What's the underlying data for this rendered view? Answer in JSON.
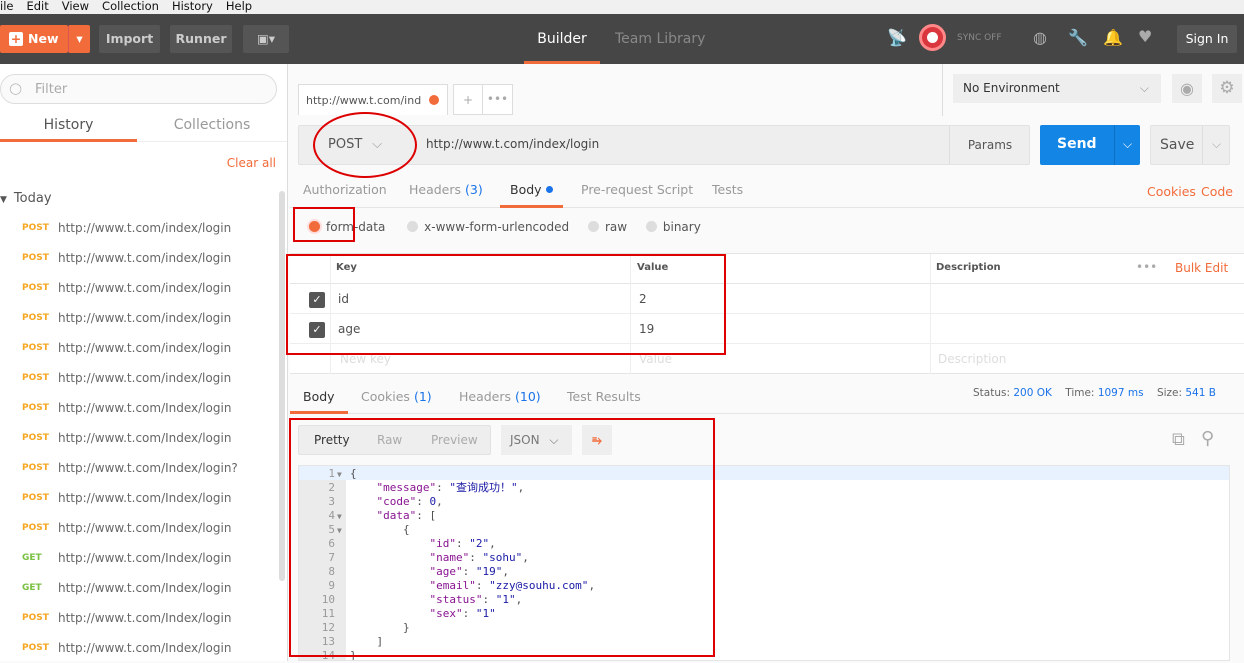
{
  "menu": [
    "ile",
    "Edit",
    "View",
    "Collection",
    "History",
    "Help"
  ],
  "topbar": {
    "new_label": "New",
    "import_label": "Import",
    "runner_label": "Runner",
    "tabs": [
      "Builder",
      "Team Library"
    ],
    "sync_label": "SYNC OFF",
    "sign_in_label": "Sign In"
  },
  "sidebar": {
    "filter_placeholder": "Filter",
    "tabs": [
      "History",
      "Collections"
    ],
    "clear_all": "Clear all",
    "group": "Today",
    "items": [
      {
        "method": "POST",
        "url": "http://www.t.com/index/login"
      },
      {
        "method": "POST",
        "url": "http://www.t.com/index/login"
      },
      {
        "method": "POST",
        "url": "http://www.t.com/index/login"
      },
      {
        "method": "POST",
        "url": "http://www.t.com/index/login"
      },
      {
        "method": "POST",
        "url": "http://www.t.com/index/login"
      },
      {
        "method": "POST",
        "url": "http://www.t.com/index/login"
      },
      {
        "method": "POST",
        "url": "http://www.t.com/Index/login"
      },
      {
        "method": "POST",
        "url": "http://www.t.com/Index/login"
      },
      {
        "method": "POST",
        "url": "http://www.t.com/Index/login?"
      },
      {
        "method": "POST",
        "url": "http://www.t.com/Index/login"
      },
      {
        "method": "POST",
        "url": "http://www.t.com/Index/login"
      },
      {
        "method": "GET",
        "url": "http://www.t.com/Index/login"
      },
      {
        "method": "GET",
        "url": "http://www.t.com/Index/login"
      },
      {
        "method": "POST",
        "url": "http://www.t.com/Index/login"
      },
      {
        "method": "POST",
        "url": "http://www.t.com/Index/login"
      }
    ]
  },
  "colors": {
    "accent": "#f26b3a",
    "post": "#f5a623",
    "get": "#7ac143",
    "send": "#1385e5"
  },
  "request_tab": {
    "title": "http://www.t.com/ind"
  },
  "environment": {
    "selected": "No Environment"
  },
  "request": {
    "method": "POST",
    "url": "http://www.t.com/index/login",
    "params_label": "Params",
    "send_label": "Send",
    "save_label": "Save"
  },
  "request_tabs": {
    "authorization": "Authorization",
    "headers": "Headers",
    "headers_count": "(3)",
    "body": "Body",
    "prerequest": "Pre-request Script",
    "tests": "Tests",
    "cookies": "Cookies",
    "code": "Code"
  },
  "body_modes": {
    "selected": "form-data",
    "options": [
      "form-data",
      "x-www-form-urlencoded",
      "raw",
      "binary"
    ]
  },
  "form_table": {
    "headers": [
      "Key",
      "Value",
      "Description"
    ],
    "bulk_edit": "Bulk Edit",
    "rows": [
      {
        "checked": true,
        "key": "id",
        "value": "2"
      },
      {
        "checked": true,
        "key": "age",
        "value": "19"
      }
    ],
    "placeholders": {
      "key": "New key",
      "value": "Value",
      "description": "Description"
    }
  },
  "response_tabs": {
    "body": "Body",
    "cookies": "Cookies",
    "cookies_count": "(1)",
    "headers": "Headers",
    "headers_count": "(10)",
    "test_results": "Test Results"
  },
  "response_meta": {
    "status_label": "Status:",
    "status": "200 OK",
    "time_label": "Time:",
    "time": "1097 ms",
    "size_label": "Size:",
    "size": "541 B"
  },
  "response_toolbar": {
    "views": [
      "Pretty",
      "Raw",
      "Preview"
    ],
    "format": "JSON"
  },
  "response_body": [
    {
      "n": "1",
      "fold": true,
      "t": [
        [
          "p",
          "{"
        ]
      ]
    },
    {
      "n": "2",
      "t": [
        [
          "p",
          "    "
        ],
        [
          "k",
          "\"message\""
        ],
        [
          "p",
          ": "
        ],
        [
          "s",
          "\"查询成功！\""
        ],
        [
          "p",
          ","
        ]
      ]
    },
    {
      "n": "3",
      "t": [
        [
          "p",
          "    "
        ],
        [
          "k",
          "\"code\""
        ],
        [
          "p",
          ": "
        ],
        [
          "n",
          "0"
        ],
        [
          "p",
          ","
        ]
      ]
    },
    {
      "n": "4",
      "fold": true,
      "t": [
        [
          "p",
          "    "
        ],
        [
          "k",
          "\"data\""
        ],
        [
          "p",
          ": ["
        ]
      ]
    },
    {
      "n": "5",
      "fold": true,
      "t": [
        [
          "p",
          "        {"
        ]
      ]
    },
    {
      "n": "6",
      "t": [
        [
          "p",
          "            "
        ],
        [
          "k",
          "\"id\""
        ],
        [
          "p",
          ": "
        ],
        [
          "s",
          "\"2\""
        ],
        [
          "p",
          ","
        ]
      ]
    },
    {
      "n": "7",
      "t": [
        [
          "p",
          "            "
        ],
        [
          "k",
          "\"name\""
        ],
        [
          "p",
          ": "
        ],
        [
          "s",
          "\"sohu\""
        ],
        [
          "p",
          ","
        ]
      ]
    },
    {
      "n": "8",
      "t": [
        [
          "p",
          "            "
        ],
        [
          "k",
          "\"age\""
        ],
        [
          "p",
          ": "
        ],
        [
          "s",
          "\"19\""
        ],
        [
          "p",
          ","
        ]
      ]
    },
    {
      "n": "9",
      "t": [
        [
          "p",
          "            "
        ],
        [
          "k",
          "\"email\""
        ],
        [
          "p",
          ": "
        ],
        [
          "s",
          "\"zzy@souhu.com\""
        ],
        [
          "p",
          ","
        ]
      ]
    },
    {
      "n": "10",
      "t": [
        [
          "p",
          "            "
        ],
        [
          "k",
          "\"status\""
        ],
        [
          "p",
          ": "
        ],
        [
          "s",
          "\"1\""
        ],
        [
          "p",
          ","
        ]
      ]
    },
    {
      "n": "11",
      "t": [
        [
          "p",
          "            "
        ],
        [
          "k",
          "\"sex\""
        ],
        [
          "p",
          ": "
        ],
        [
          "s",
          "\"1\""
        ]
      ]
    },
    {
      "n": "12",
      "t": [
        [
          "p",
          "        }"
        ]
      ]
    },
    {
      "n": "13",
      "t": [
        [
          "p",
          "    ]"
        ]
      ]
    },
    {
      "n": "14",
      "t": [
        [
          "p",
          "}"
        ]
      ]
    }
  ]
}
